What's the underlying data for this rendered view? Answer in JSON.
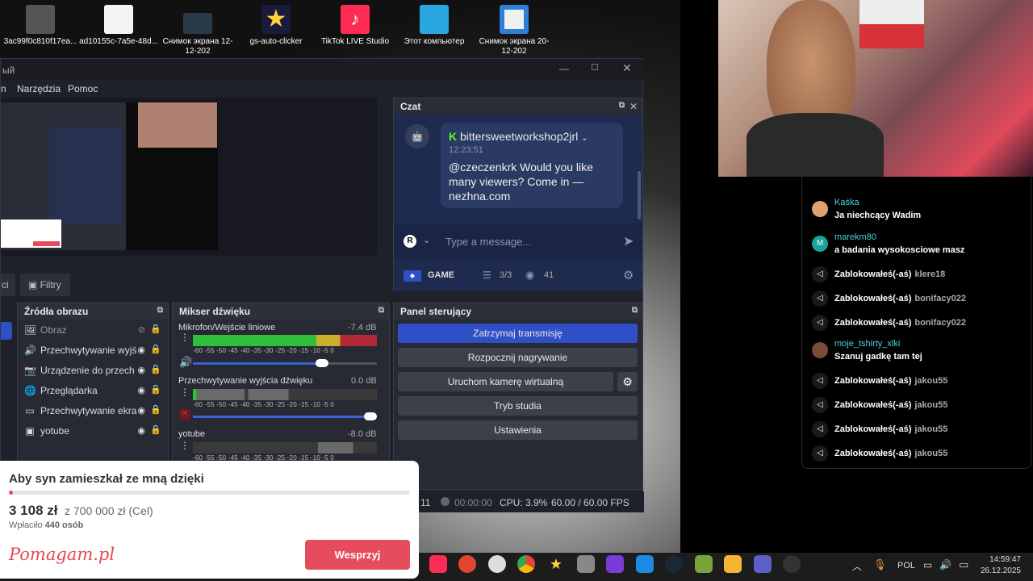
{
  "desktop_icons": [
    {
      "label": "3ac99f0c810f17ea...",
      "color": "#555"
    },
    {
      "label": "ad10155c-7a5e-48d...",
      "color": "#f4f4f4"
    },
    {
      "label": "Снимок экрана 12-12-202",
      "color": "#2b3a4a"
    },
    {
      "label": "gs-auto-clicker",
      "color": "#2243a8"
    },
    {
      "label": "TikTok LIVE Studio",
      "color": "#fe2c55"
    },
    {
      "label": "Этот компьютер",
      "color": "#2aa7e0"
    },
    {
      "label": "Снимок экрана 20-12-202",
      "color": "#2f7fd6"
    }
  ],
  "obs": {
    "title_fragment": "ый",
    "menu": [
      "n",
      "Narzędzia",
      "Pomoc"
    ],
    "filters_label": "Filtry",
    "sources_left_tab": "ci",
    "chat_panel": {
      "title": "Czat",
      "username": "bittersweetworkshop2jrl",
      "time": "12:23:51",
      "message": "@czeczenkrk Would you like many viewers? Come in — nezhna.com",
      "input_placeholder": "Type a message...",
      "game_label": "GAME",
      "slots": "3/3",
      "viewers": "41"
    },
    "sources": {
      "title": "Źródła obrazu",
      "items": [
        {
          "label": "Obraz",
          "hidden": true
        },
        {
          "label": "Przechwytywanie wyjś"
        },
        {
          "label": "Urządzenie do przech"
        },
        {
          "label": "Przeglądarka"
        },
        {
          "label": "Przechwytywanie ekra"
        },
        {
          "label": "yotube"
        }
      ]
    },
    "mixer": {
      "title": "Mikser dźwięku",
      "channels": [
        {
          "name": "Mikrofon/Wejście liniowe",
          "db": "-7.4 dB"
        },
        {
          "name": "Przechwytywanie wyjścia dźwięku",
          "db": "0.0 dB"
        },
        {
          "name": "yotube",
          "db": "-8.0 dB"
        }
      ],
      "scale": "-60 -55 -50 -45 -40 -35 -30 -25 -20 -15 -10 -5 0"
    },
    "control": {
      "title": "Panel sterujący",
      "buttons": [
        "Zatrzymaj transmisję",
        "Rozpocznij nagrywanie",
        "Uruchom kamerę wirtualną",
        "Tryb studia",
        "Ustawienia"
      ]
    },
    "status": {
      "left": "11",
      "rec_time": "00:00:00",
      "cpu": "CPU: 3.9%",
      "fps": "60.00 / 60.00 FPS"
    }
  },
  "donation": {
    "title": "Aby syn zamieszkał ze mną dzięki",
    "amount": "3 108 zł",
    "goal": "z 700 000 zł (Cel)",
    "donors_prefix": "Wpłaciło",
    "donors_count": "440 osób",
    "logo": "Pomagam.pl",
    "button": "Wesprzyj",
    "progress_fraction": 0.0044
  },
  "tiktok_chat": [
    {
      "type": "msg",
      "user": "Kaśka",
      "text": "Ja niechcący Wadim",
      "avatar_color": "#e0a070",
      "user_color": "#4fd1e6"
    },
    {
      "type": "msg",
      "user": "marekm80",
      "text": "a badania wysokosciowe masz",
      "avatar_color": "#1aa39a",
      "avatar_letter": "M",
      "user_color": "#4fd1e6"
    },
    {
      "type": "block",
      "text": "Zablokowałeś(-aś)",
      "target": "klere18"
    },
    {
      "type": "block",
      "text": "Zablokowałeś(-aś)",
      "target": "bonifacy022"
    },
    {
      "type": "block",
      "text": "Zablokowałeś(-aś)",
      "target": "bonifacy022"
    },
    {
      "type": "msg",
      "user": "moje_tshirty_xlki",
      "text": "Szanuj gadkę tam tej",
      "avatar_color": "#7a4a3a",
      "user_color": "#4fd1e6"
    },
    {
      "type": "block",
      "text": "Zablokowałeś(-aś)",
      "target": "jakou55"
    },
    {
      "type": "block",
      "text": "Zablokowałeś(-aś)",
      "target": "jakou55"
    },
    {
      "type": "block",
      "text": "Zablokowałeś(-aś)",
      "target": "jakou55"
    },
    {
      "type": "block",
      "text": "Zablokowałeś(-aś)",
      "target": "jakou55"
    }
  ],
  "taskbar": {
    "lang": "POL",
    "time": "14:59:47",
    "date": "26.12.2025"
  },
  "colors": {
    "obs_bg": "#1f212a",
    "stop_button": "#2f4fc7",
    "donate_button": "#e54d5e",
    "logo": "#e5484d"
  }
}
